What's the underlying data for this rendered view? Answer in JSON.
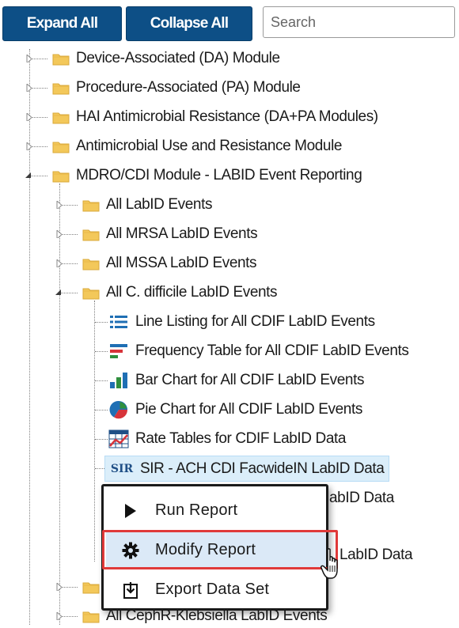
{
  "toolbar": {
    "expand_label": "Expand All",
    "collapse_label": "Collapse All",
    "search_placeholder": "Search"
  },
  "tree": {
    "modules": [
      {
        "label": "Device-Associated (DA) Module"
      },
      {
        "label": "Procedure-Associated (PA) Module"
      },
      {
        "label": "HAI Antimicrobial Resistance (DA+PA Modules)"
      },
      {
        "label": "Antimicrobial Use and Resistance Module"
      },
      {
        "label": "MDRO/CDI Module - LABID Event Reporting"
      }
    ],
    "mdro_children": [
      {
        "label": "All LabID Events"
      },
      {
        "label": "All MRSA LabID Events"
      },
      {
        "label": "All MSSA LabID Events"
      },
      {
        "label": "All C. difficile LabID Events"
      }
    ],
    "cdif_reports": [
      {
        "label": "Line Listing for All CDIF LabID Events",
        "icon": "line-listing-icon"
      },
      {
        "label": "Frequency Table for All CDIF LabID Events",
        "icon": "frequency-table-icon"
      },
      {
        "label": "Bar Chart for All CDIF LabID Events",
        "icon": "bar-chart-icon"
      },
      {
        "label": "Pie Chart for All CDIF LabID Events",
        "icon": "pie-chart-icon"
      },
      {
        "label": "Rate Tables for CDIF LabID Data",
        "icon": "rate-table-icon"
      },
      {
        "label": "SIR - ACH CDI FacwideIN LabID Data",
        "icon": "sir-icon",
        "icon_text": "SIR"
      }
    ],
    "hidden_fragments": [
      "abID Data",
      "LabID Data"
    ],
    "bottom_item": {
      "label": "All CephR-Klebsiella LabID Events"
    }
  },
  "context_menu": {
    "items": [
      {
        "label": "Run Report",
        "icon": "play-icon"
      },
      {
        "label": "Modify Report",
        "icon": "gear-icon"
      },
      {
        "label": "Export Data Set",
        "icon": "export-icon"
      }
    ]
  },
  "colors": {
    "button_bg": "#0d4f86",
    "folder": "#f3c85a",
    "selection_bg": "#dbeefa",
    "highlight_border": "#e03a3a"
  }
}
